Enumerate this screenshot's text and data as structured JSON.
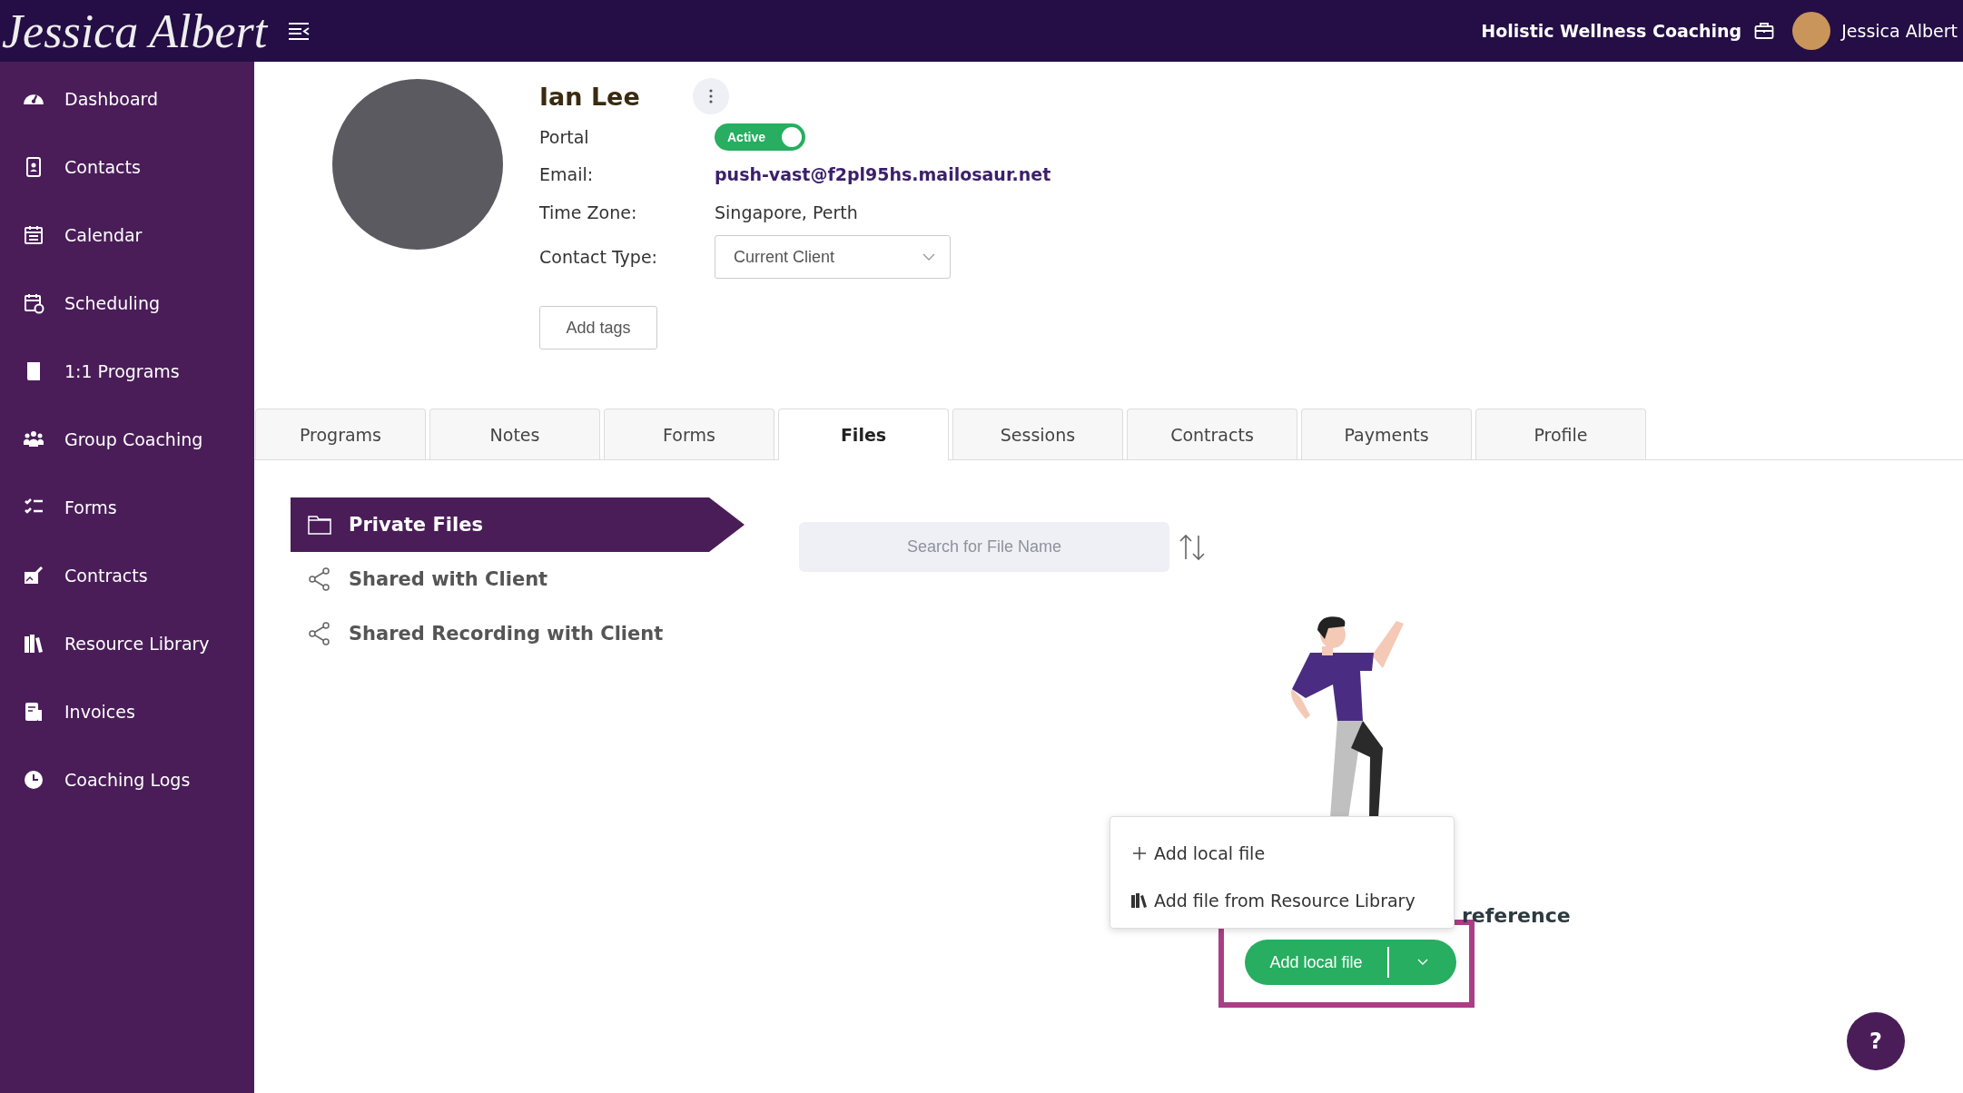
{
  "topbar": {
    "logo": "Jessica Albert",
    "business": "Holistic Wellness Coaching",
    "user": "Jessica Albert"
  },
  "sidebar": {
    "items": [
      {
        "label": "Dashboard",
        "kind": "dashboard"
      },
      {
        "label": "Contacts",
        "kind": "contacts"
      },
      {
        "label": "Calendar",
        "kind": "calendar"
      },
      {
        "label": "Scheduling",
        "kind": "scheduling"
      },
      {
        "label": "1:1 Programs",
        "kind": "book"
      },
      {
        "label": "Group Coaching",
        "kind": "group"
      },
      {
        "label": "Forms",
        "kind": "forms"
      },
      {
        "label": "Contracts",
        "kind": "contracts"
      },
      {
        "label": "Resource Library",
        "kind": "library"
      },
      {
        "label": "Invoices",
        "kind": "invoices"
      },
      {
        "label": "Coaching Logs",
        "kind": "clock"
      }
    ]
  },
  "contact": {
    "name": "Ian Lee",
    "fields": [
      {
        "label": "Portal",
        "kind": "toggle",
        "value": "Active",
        "on": true
      },
      {
        "label": "Email:",
        "kind": "link",
        "value": "push-vast@f2pl95hs.mailosaur.net"
      },
      {
        "label": "Time Zone:",
        "kind": "text",
        "value": "Singapore, Perth"
      },
      {
        "label": "Contact Type:",
        "kind": "select",
        "value": "Current Client"
      }
    ],
    "add_tags": "Add tags"
  },
  "tabs": [
    {
      "label": "Programs",
      "selected": false
    },
    {
      "label": "Notes",
      "selected": false
    },
    {
      "label": "Forms",
      "selected": false
    },
    {
      "label": "Files",
      "selected": true
    },
    {
      "label": "Sessions",
      "selected": false
    },
    {
      "label": "Contracts",
      "selected": false
    },
    {
      "label": "Payments",
      "selected": false
    },
    {
      "label": "Profile",
      "selected": false
    }
  ],
  "folders": [
    {
      "label": "Private Files",
      "kind": "folder",
      "selected": true
    },
    {
      "label": "Shared with Client",
      "kind": "share",
      "selected": false
    },
    {
      "label": "Shared Recording with Client",
      "kind": "share",
      "selected": false
    }
  ],
  "search": {
    "placeholder": "Search for File Name"
  },
  "empty_state": {
    "text": "reference"
  },
  "menu": {
    "items": [
      {
        "label": "Add local file",
        "kind": "add"
      },
      {
        "label": "Add file from Resource Library",
        "kind": "library"
      }
    ]
  },
  "upload_button": {
    "label": "Add local file"
  },
  "help": {
    "label": "?"
  }
}
